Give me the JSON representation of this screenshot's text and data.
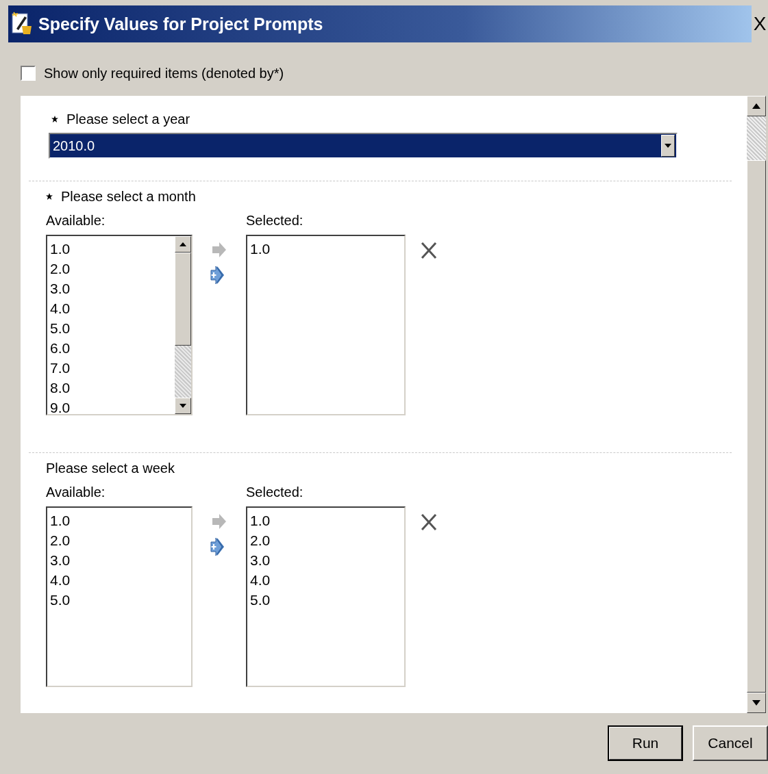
{
  "window": {
    "title": "Specify Values for Project Prompts",
    "close": "X"
  },
  "required_only": {
    "label": "Show only required items (denoted by*)",
    "checked": false
  },
  "prompts": [
    {
      "kind": "dropdown",
      "required": true,
      "label": "Please select a year",
      "value": "2010.0"
    },
    {
      "kind": "picker",
      "required": true,
      "label": "Please select a month",
      "available_label": "Available:",
      "available": [
        "1.0",
        "2.0",
        "3.0",
        "4.0",
        "5.0",
        "6.0",
        "7.0",
        "8.0",
        "9.0"
      ],
      "scrollable": true,
      "selected_label": "Selected:",
      "selected": [
        "1.0"
      ]
    },
    {
      "kind": "picker",
      "required": false,
      "label": "Please select a week",
      "available_label": "Available:",
      "available": [
        "1.0",
        "2.0",
        "3.0",
        "4.0",
        "5.0"
      ],
      "scrollable": false,
      "selected_label": "Selected:",
      "selected": [
        "1.0",
        "2.0",
        "3.0",
        "4.0",
        "5.0"
      ]
    }
  ],
  "buttons": [
    {
      "label": "Run",
      "default": true
    },
    {
      "label": "Cancel",
      "default": false
    }
  ]
}
